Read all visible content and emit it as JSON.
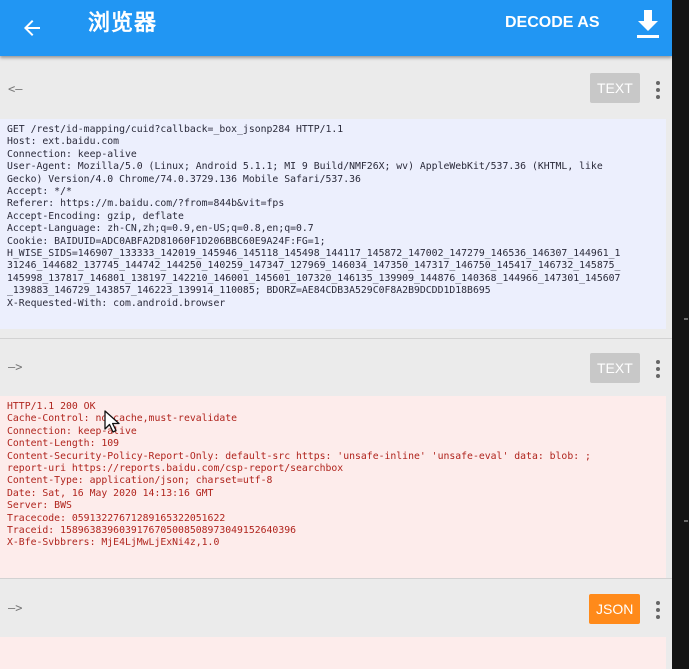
{
  "appbar": {
    "title": "浏览器",
    "decode_label": "DECODE AS",
    "back_icon": "arrow-left-icon",
    "download_icon": "download-icon",
    "color": "#2196f3"
  },
  "request": {
    "arrow": "<—",
    "badge": "TEXT",
    "lines": [
      "GET /rest/id-mapping/cuid?callback=_box_jsonp284 HTTP/1.1",
      "Host: ext.baidu.com",
      "Connection: keep-alive",
      "User-Agent: Mozilla/5.0 (Linux; Android 5.1.1; MI 9 Build/NMF26X; wv) AppleWebKit/537.36 (KHTML, like",
      "Gecko) Version/4.0 Chrome/74.0.3729.136 Mobile Safari/537.36",
      "Accept: */*",
      "Referer: https://m.baidu.com/?from=844b&vit=fps",
      "Accept-Encoding: gzip, deflate",
      "Accept-Language: zh-CN,zh;q=0.9,en-US;q=0.8,en;q=0.7",
      "Cookie: BAIDUID=ADC0ABFA2D81060F1D206BBC60E9A24F:FG=1;",
      "H_WISE_SIDS=146907_133333_142019_145946_145118_145498_144117_145872_147002_147279_146536_146307_144961_1",
      "31246_144682_137745_144742_144250_140259_147347_127969_146034_147350_147317_146750_145417_146732_145875_",
      "145998_137817_146801_138197_142210_146001_145601_107320_146135_139909_144876_140368_144966_147301_145607",
      "_139883_146729_143857_146223_139914_110085; BDORZ=AE84CDB3A529C0F8A2B9DCDD1D18B695",
      "X-Requested-With: com.android.browser"
    ]
  },
  "response": {
    "arrow": "—>",
    "badge": "TEXT",
    "lines": [
      "HTTP/1.1 200 OK",
      "Cache-Control: no-cache,must-revalidate",
      "Connection: keep-alive",
      "Content-Length: 109",
      "Content-Security-Policy-Report-Only: default-src https: 'unsafe-inline' 'unsafe-eval' data: blob: ;",
      "report-uri https://reports.baidu.com/csp-report/searchbox",
      "Content-Type: application/json; charset=utf-8",
      "Date: Sat, 16 May 2020 14:13:16 GMT",
      "Server: BWS",
      "Tracecode: 05913227671289165322051622",
      "Traceid: 1589638396039176705008508973049152640396",
      "X-Bfe-Svbbrers: MjE4LjMwLjExNi4z,1.0"
    ]
  },
  "body_section": {
    "arrow": "—>",
    "badge": "JSON",
    "badge_color": "#ff8a1a"
  }
}
